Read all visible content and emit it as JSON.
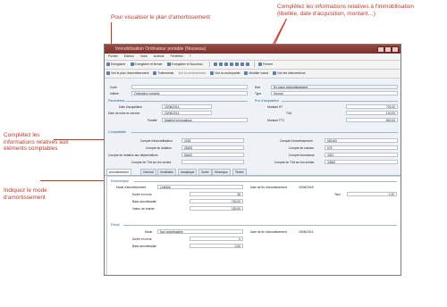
{
  "annotations": {
    "plan": "Pour visualiser le plan d'amortissement",
    "infos": "Complétez les informations relatives à l'immobilisation (libellée, date d'acquisition, montant…)",
    "comptes": "Complétez les informations relatives aux éléments comptables",
    "mode": "Indiquez le mode d'amortissement"
  },
  "window": {
    "title": "Immobilisation Ordinateur portable (Nouveau)"
  },
  "menu": [
    "Fichier",
    "Edition",
    "Vues",
    "Actions",
    "Fenêtres",
    "?"
  ],
  "toolbar1": {
    "save": "Enregistrer",
    "save_close": "Enregistrer et fermer",
    "save_new": "Enregistrer et Nouveau",
    "close": "Fermer"
  },
  "toolbar2": {
    "plan": "Voir le plan d'amortissement",
    "treatments": "Traitements",
    "sale": "Voir la vente/cession",
    "verify": "Voir la contrepartie",
    "calc": "Modifier calcul",
    "interventions": "Voir les interventions"
  },
  "header": {
    "code_label": "Code",
    "code_value": "",
    "intitule_label": "Intitulé",
    "intitule_value": "Ordinateur portable",
    "etat_label": "Etat",
    "etat_value": "En cours d'amortissement",
    "type_label": "Type",
    "type_value": "Normal"
  },
  "params": {
    "title": "Paramètres",
    "acq_label": "Date d'acquisition",
    "acq_value": "20/06/2014",
    "mes_label": "Date de mise en service",
    "mes_value": "20/06/2014",
    "famille_label": "Famille",
    "famille_value": "Matériel informatique"
  },
  "prix": {
    "title": "Prix d'acquisition",
    "ht_label": "Montant HT",
    "ht_value": "700,00",
    "tva_label": "TVA",
    "tva_value": "140,00",
    "ttc_label": "Montant TTC",
    "ttc_value": "840,00"
  },
  "comptabilite": {
    "title": "Comptabilité",
    "immo_label": "Compte d'immobilisation",
    "immo_value": "2183",
    "dotation_label": "Compte de dotation",
    "dotation_value": "28183",
    "dot_dep_label": "Compte de dotation aux dépréciations",
    "dot_dep_value": "68162",
    "tva_vente_label": "Compte de TVA sur les ventes",
    "tva_vente_value": "",
    "amort_label": "Compte d'amortissement",
    "amort_value": "681163",
    "cession_label": "Compte de cession",
    "cession_value": "675",
    "fourn_label": "Compte fournisseur",
    "fourn_value": "4041",
    "tva_achat_label": "Compte de TVA sur les achats",
    "tva_achat_value": "44562"
  },
  "tabs": [
    "Amortissement",
    "Général",
    "Ventilation",
    "Analytique",
    "Sortie",
    "Historique",
    "Textes"
  ],
  "economique": {
    "title": "Economique",
    "mode_label": "Mode d'amortissement",
    "mode_value": "Linéaire",
    "duree_label": "Durée en mois",
    "duree_value": "36",
    "base_label": "Base amortissable",
    "base_value": "700,00",
    "reprise_label": "Valeur de reprise",
    "reprise_value": "150,00",
    "fin_label": "Date de fin d'amortissement",
    "fin_value": "20/06/2018",
    "taux_label": "Taux",
    "taux_value": "0,30"
  },
  "fiscal": {
    "title": "Fiscal",
    "mode_label": "Mode",
    "mode_value": "Non amortissable",
    "duree_label": "Durée en mois",
    "duree_value": "0",
    "base_label": "Base amortissable",
    "base_value": "0,00",
    "fin_label": "Date de fin d'amortissement",
    "fin_value": "20/06/2014"
  }
}
